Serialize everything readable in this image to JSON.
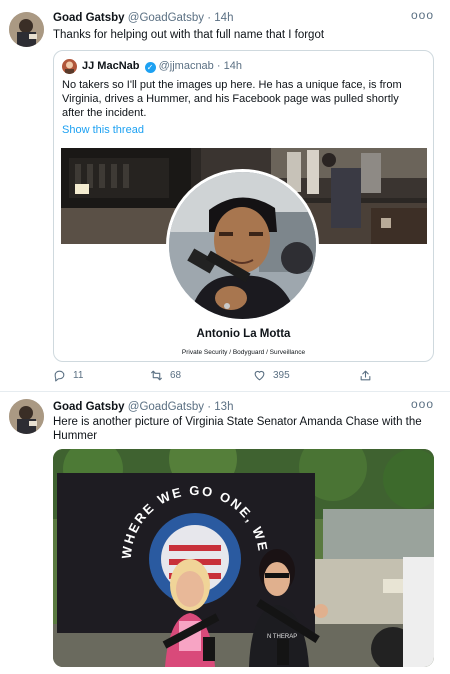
{
  "tweet1": {
    "author_name": "Goad Gatsby",
    "handle": "@GoadGatsby",
    "separator": "·",
    "time": "14h",
    "more_label": "ooo",
    "text": "Thanks for helping out with that full name that I forgot",
    "quote": {
      "author_name": "JJ MacNab",
      "verified_mark": "✓",
      "handle": "@jjmacnab",
      "separator": "·",
      "time": "14h",
      "text": "No takers so I'll put the images up here.  He has a unique face, is from Virginia, drives a Hummer, and his Facebook page was pulled shortly after the incident.",
      "show_thread": "Show this thread",
      "profile_name": "Antonio La Motta",
      "profile_subtitle": "Private Security / Bodyguard / Surveillance"
    },
    "actions": {
      "replies": "11",
      "retweets": "68",
      "likes": "395",
      "share": ""
    }
  },
  "tweet2": {
    "author_name": "Goad Gatsby",
    "handle": "@GoadGatsby",
    "separator": "·",
    "time": "13h",
    "more_label": "ooo",
    "text": "Here is another picture of Virginia State Senator Amanda Chase with the Hummer",
    "photo": {
      "flag_text": "WHERE WE GO ONE, WE GO",
      "shirt_text": "N THERAP"
    }
  },
  "colors": {
    "accent": "#1da1f2",
    "muted": "#5b7083",
    "border": "#cfd9de"
  },
  "icons": {
    "reply": "reply-icon",
    "retweet": "retweet-icon",
    "like": "heart-icon",
    "share": "share-icon",
    "verified": "verified-badge-icon"
  }
}
